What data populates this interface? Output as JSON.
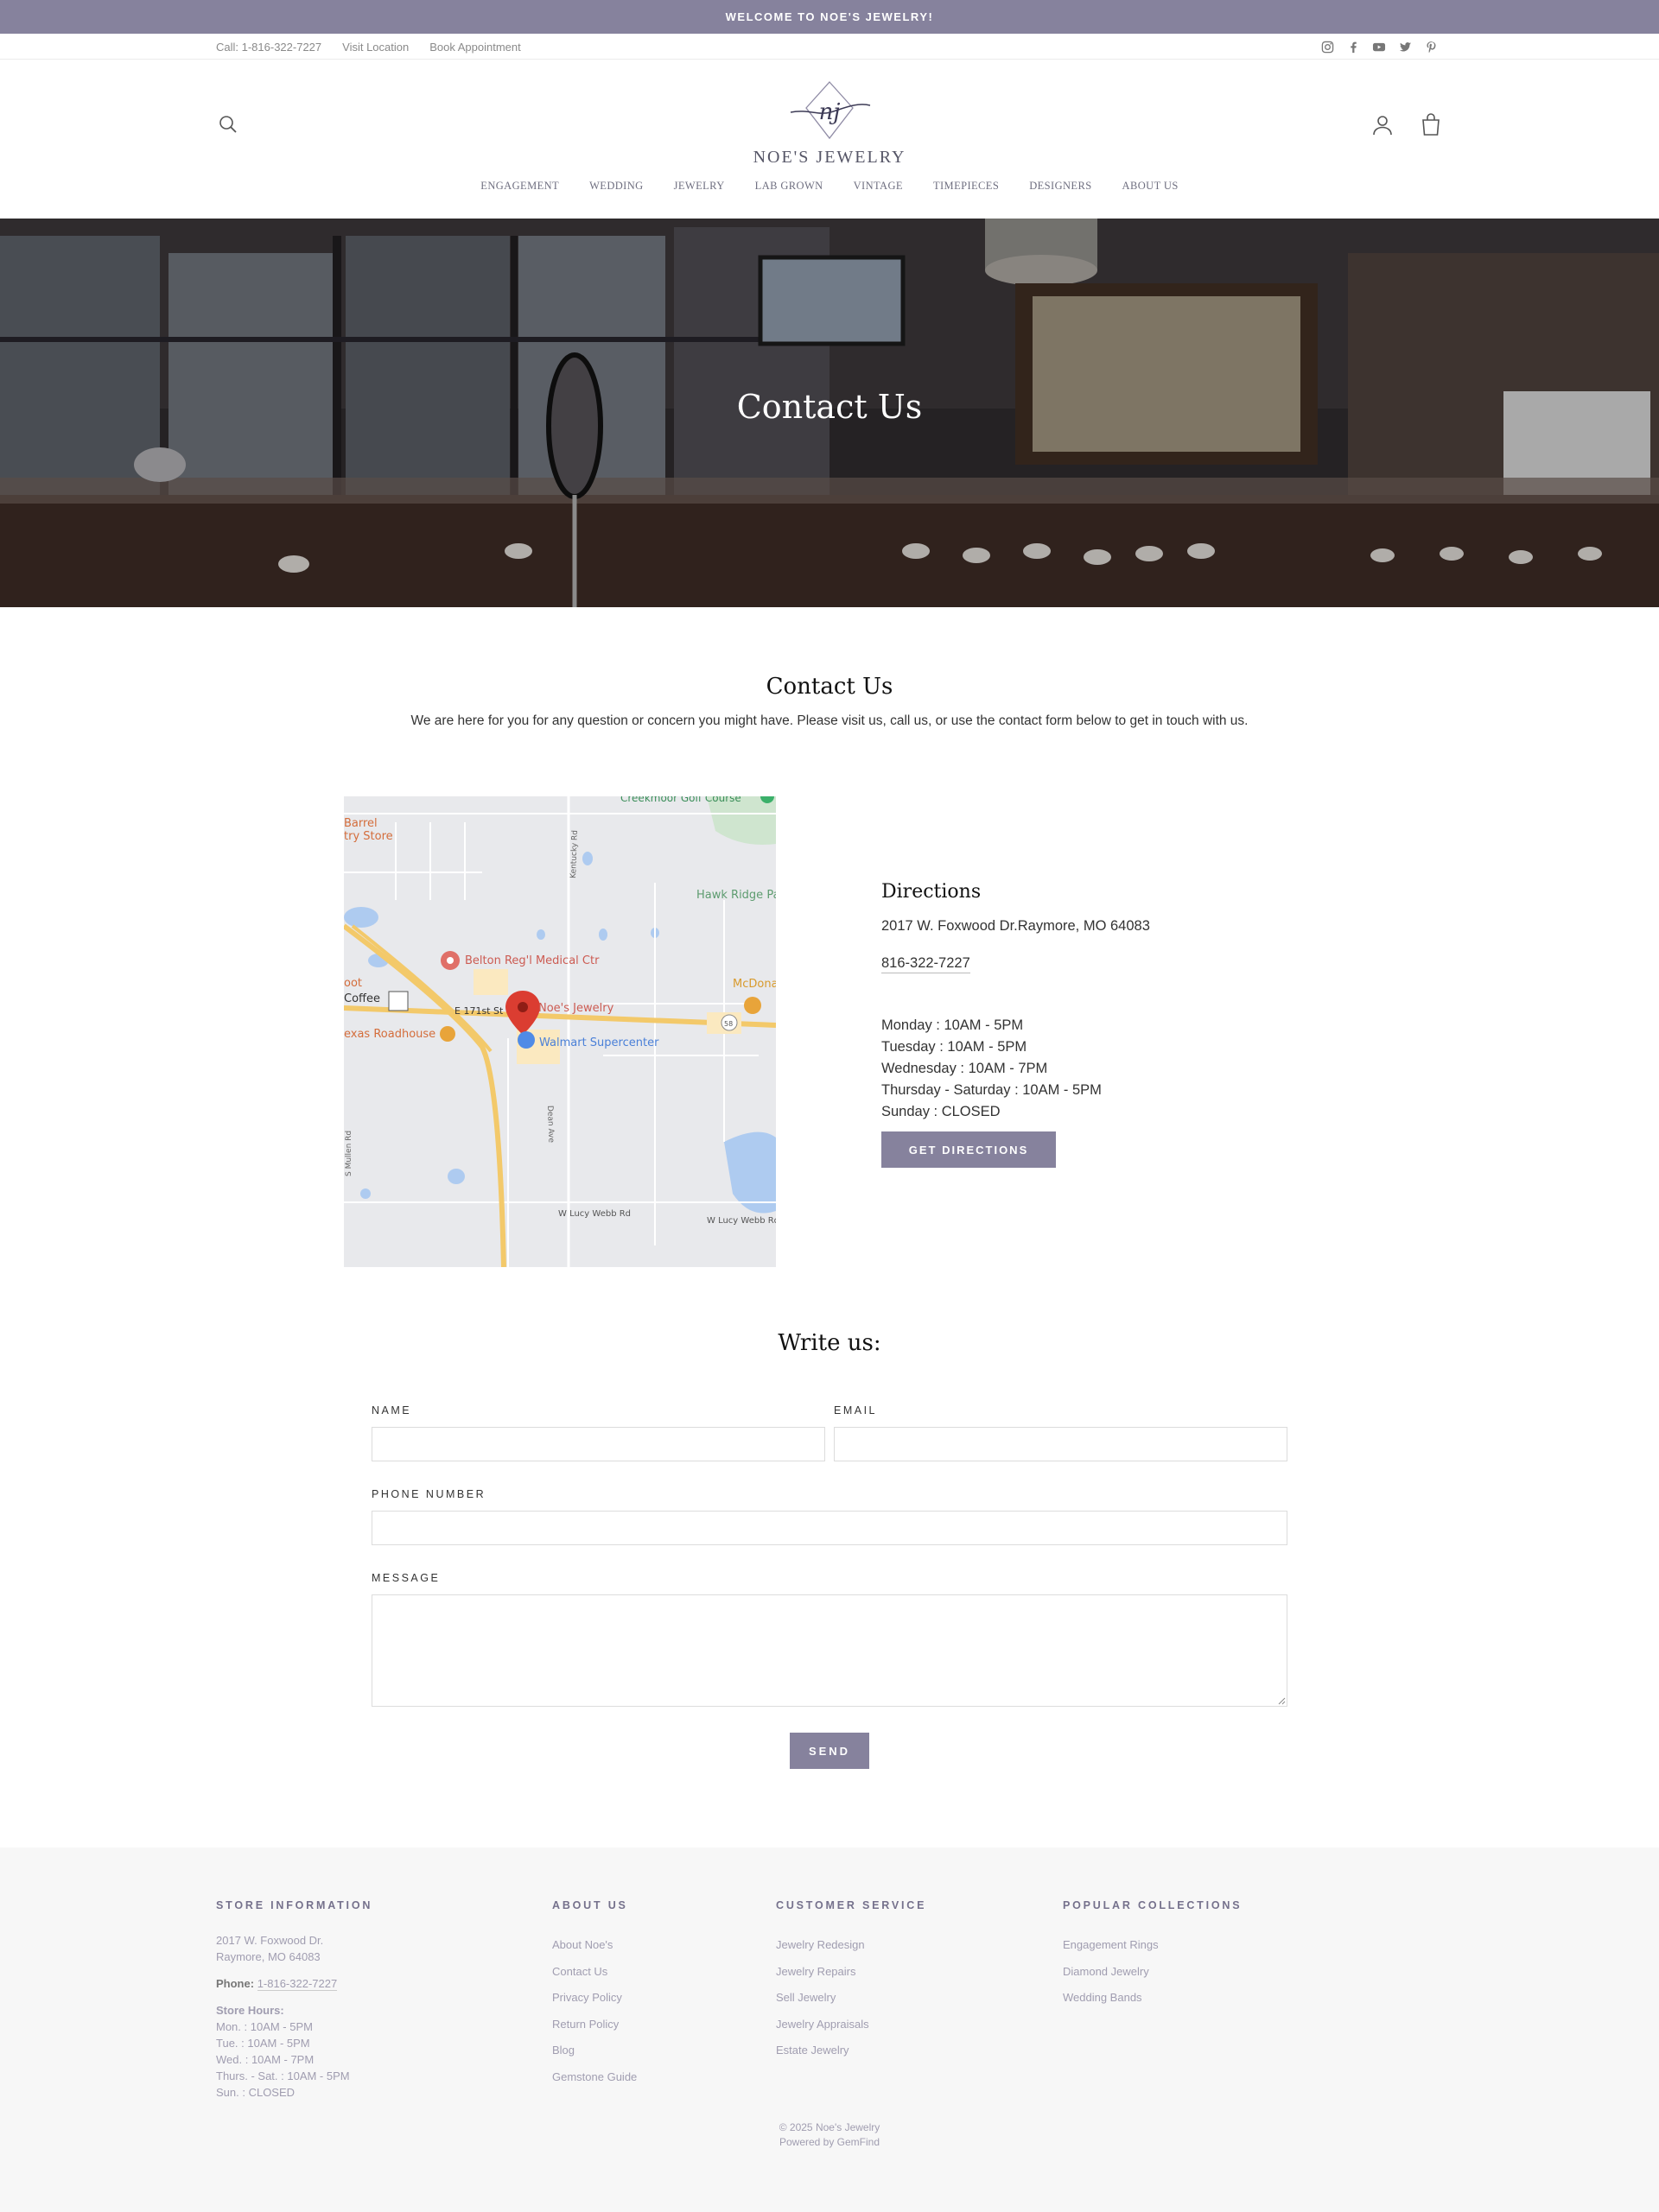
{
  "announcement": "WELCOME TO NOE'S JEWELRY!",
  "utility": {
    "call": "Call: 1-816-322-7227",
    "visit": "Visit Location",
    "book": "Book Appointment",
    "social": [
      "instagram-icon",
      "facebook-icon",
      "youtube-icon",
      "twitter-icon",
      "pinterest-icon"
    ]
  },
  "brand": {
    "monogram": "nj",
    "name": "NOE'S JEWELRY"
  },
  "nav": [
    "ENGAGEMENT",
    "WEDDING",
    "JEWELRY",
    "LAB GROWN",
    "VINTAGE",
    "TIMEPIECES",
    "DESIGNERS",
    "ABOUT US"
  ],
  "hero": {
    "title": "Contact Us"
  },
  "intro": {
    "title": "Contact Us",
    "text": "We are here for you for any question or concern you might have. Please visit us, call us, or use the contact form below to get in touch with us."
  },
  "map": {
    "labels": {
      "golf": "Creekmoor Golf Course",
      "barrel": "Barrel",
      "country_store": "try Store",
      "kentucky": "Kentucky Rd",
      "hawk": "Hawk Ridge Pa",
      "medical": "Belton Reg'l Medical Ctr",
      "noes": "Noe's Jewelry",
      "mcdonalds": "McDona",
      "coffee": "Coffee",
      "oot": "oot",
      "street": "E 171st St",
      "walmart": "Walmart Supercenter",
      "roadhouse": "exas Roadhouse",
      "route": "58",
      "dean": "Dean Ave",
      "mullen": "S Mullen Rd",
      "lucy1": "W Lucy Webb Rd",
      "lucy2": "W Lucy Webb Rd"
    }
  },
  "directions": {
    "title": "Directions",
    "address": "2017 W. Foxwood Dr.Raymore, MO 64083",
    "phone": "816-322-7227",
    "hours": [
      "Monday : 10AM - 5PM",
      "Tuesday : 10AM - 5PM",
      "Wednesday : 10AM - 7PM",
      "Thursday - Saturday : 10AM - 5PM",
      "Sunday : CLOSED"
    ],
    "button": "GET DIRECTIONS"
  },
  "form": {
    "title": "Write us:",
    "name_label": "NAME",
    "email_label": "EMAIL",
    "phone_label": "PHONE NUMBER",
    "message_label": "MESSAGE",
    "send": "SEND"
  },
  "footer": {
    "store": {
      "title": "STORE INFORMATION",
      "address1": "2017 W. Foxwood Dr.",
      "address2": "Raymore, MO 64083",
      "phone_label": "Phone:",
      "phone": "1-816-322-7227",
      "hours_label": "Store Hours:",
      "hours": [
        "Mon. : 10AM - 5PM",
        "Tue. : 10AM - 5PM",
        "Wed. : 10AM - 7PM",
        "Thurs. - Sat. : 10AM - 5PM",
        "Sun. : CLOSED"
      ]
    },
    "about": {
      "title": "ABOUT US",
      "items": [
        "About Noe's",
        "Contact Us",
        "Privacy Policy",
        "Return Policy",
        "Blog",
        "Gemstone Guide"
      ]
    },
    "service": {
      "title": "CUSTOMER SERVICE",
      "items": [
        "Jewelry Redesign",
        "Jewelry Repairs",
        "Sell Jewelry",
        "Jewelry Appraisals",
        "Estate Jewelry"
      ]
    },
    "collections": {
      "title": "POPULAR COLLECTIONS",
      "items": [
        "Engagement Rings",
        "Diamond Jewelry",
        "Wedding Bands"
      ]
    },
    "copyright": "© 2025 Noe's Jewelry",
    "powered": "Powered by GemFind"
  },
  "colors": {
    "accent": "#86829d",
    "footer_bg": "#f7f7f7",
    "footer_heading": "#75718c"
  }
}
